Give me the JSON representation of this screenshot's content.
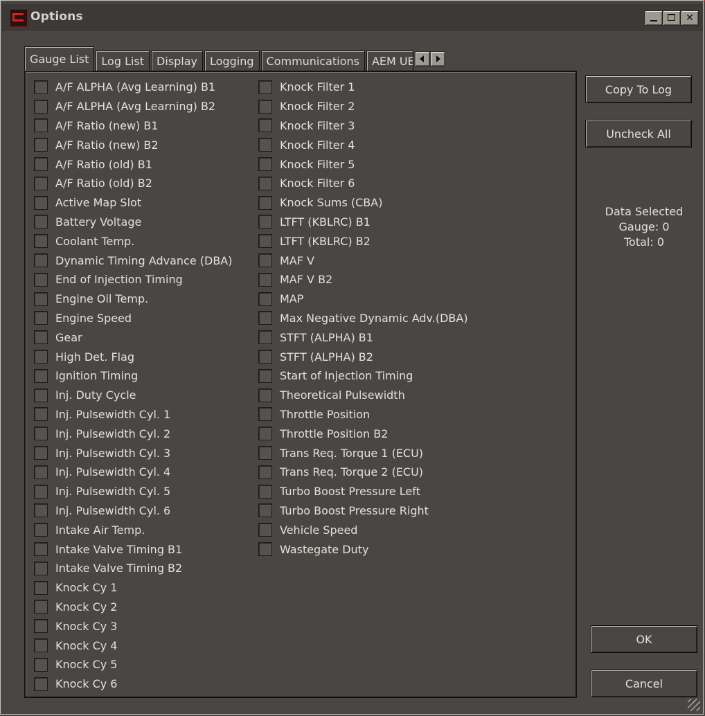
{
  "window": {
    "title": "Options"
  },
  "tabs": [
    {
      "label": "Gauge List",
      "active": true
    },
    {
      "label": "Log List",
      "active": false
    },
    {
      "label": "Display",
      "active": false
    },
    {
      "label": "Logging",
      "active": false
    },
    {
      "label": "Communications",
      "active": false
    },
    {
      "label": "AEM UE",
      "active": false
    }
  ],
  "gauges_col1": [
    "A/F ALPHA (Avg Learning) B1",
    "A/F ALPHA (Avg Learning) B2",
    "A/F Ratio (new) B1",
    "A/F Ratio (new) B2",
    "A/F Ratio (old) B1",
    "A/F Ratio (old) B2",
    "Active Map Slot",
    "Battery Voltage",
    "Coolant Temp.",
    "Dynamic Timing Advance (DBA)",
    "End of Injection Timing",
    "Engine Oil Temp.",
    "Engine Speed",
    "Gear",
    "High Det. Flag",
    "Ignition Timing",
    "Inj. Duty Cycle",
    "Inj. Pulsewidth Cyl. 1",
    "Inj. Pulsewidth Cyl. 2",
    "Inj. Pulsewidth Cyl. 3",
    "Inj. Pulsewidth Cyl. 4",
    "Inj. Pulsewidth Cyl. 5",
    "Inj. Pulsewidth Cyl. 6",
    "Intake Air Temp.",
    "Intake Valve Timing B1",
    "Intake Valve Timing B2",
    "Knock Cy 1",
    "Knock Cy 2",
    "Knock Cy 3",
    "Knock Cy 4",
    "Knock Cy 5",
    "Knock Cy 6"
  ],
  "gauges_col2": [
    "Knock Filter 1",
    "Knock Filter 2",
    "Knock Filter 3",
    "Knock Filter 4",
    "Knock Filter 5",
    "Knock Filter 6",
    "Knock Sums (CBA)",
    "LTFT (KBLRC) B1",
    "LTFT (KBLRC) B2",
    "MAF V",
    "MAF V B2",
    "MAP",
    "Max Negative Dynamic Adv.(DBA)",
    "STFT (ALPHA) B1",
    "STFT (ALPHA) B2",
    "Start of Injection Timing",
    "Theoretical Pulsewidth",
    "Throttle Position",
    "Throttle Position B2",
    "Trans Req. Torque 1 (ECU)",
    "Trans Req. Torque 2 (ECU)",
    "Turbo Boost Pressure Left",
    "Turbo Boost Pressure Right",
    "Vehicle Speed",
    "Wastegate Duty"
  ],
  "buttons": {
    "copy_to_log": "Copy To Log",
    "uncheck_all": "Uncheck All",
    "ok": "OK",
    "cancel": "Cancel"
  },
  "info": {
    "heading": "Data Selected",
    "gauge": "Gauge: 0",
    "total": "Total: 0"
  },
  "colors": {
    "background": "#4a4643",
    "accent": "#e3262b"
  }
}
